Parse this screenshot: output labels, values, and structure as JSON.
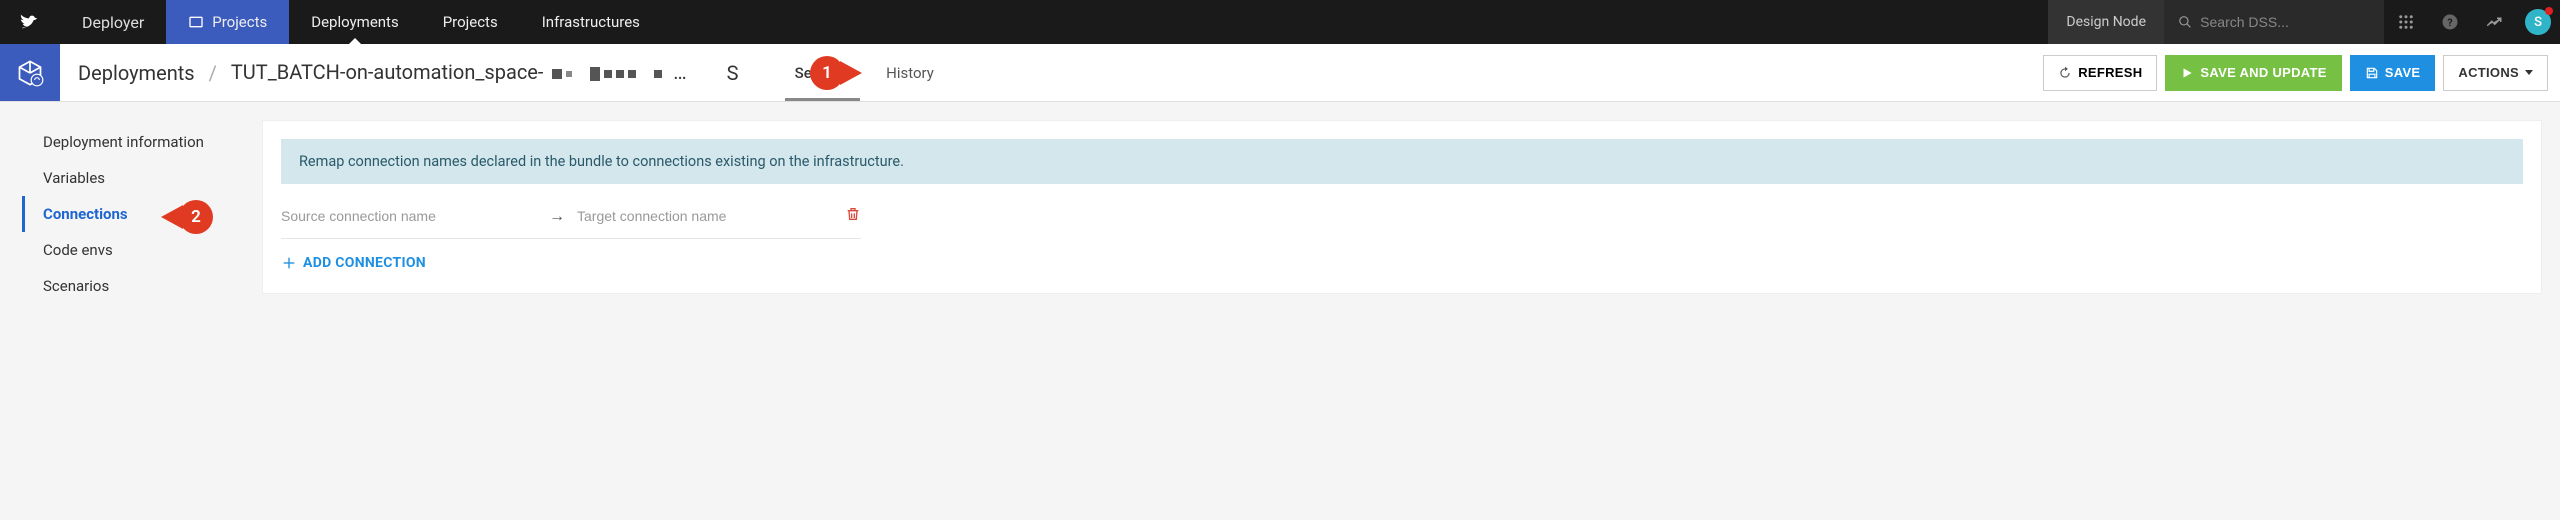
{
  "topbar": {
    "brand": "Deployer",
    "tabs": {
      "projects_primary": "Projects",
      "deployments": "Deployments",
      "projects": "Projects",
      "infrastructures": "Infrastructures"
    },
    "node": "Design Node",
    "search_placeholder": "Search DSS...",
    "avatar_initial": "S"
  },
  "header": {
    "breadcrumb_root": "Deployments",
    "breadcrumb_item": "TUT_BATCH-on-automation_space-",
    "tabs": {
      "settings": "Settings",
      "history": "History"
    },
    "buttons": {
      "refresh": "REFRESH",
      "save_update": "SAVE AND UPDATE",
      "save": "SAVE",
      "actions": "ACTIONS"
    }
  },
  "sidebar": {
    "items": [
      "Deployment information",
      "Variables",
      "Connections",
      "Code envs",
      "Scenarios"
    ],
    "active_index": 2
  },
  "panel": {
    "info": "Remap connection names declared in the bundle to connections existing on the infrastructure.",
    "source_placeholder": "Source connection name",
    "target_placeholder": "Target connection name",
    "add_label": "ADD CONNECTION"
  },
  "callouts": {
    "one": "1",
    "two": "2"
  }
}
